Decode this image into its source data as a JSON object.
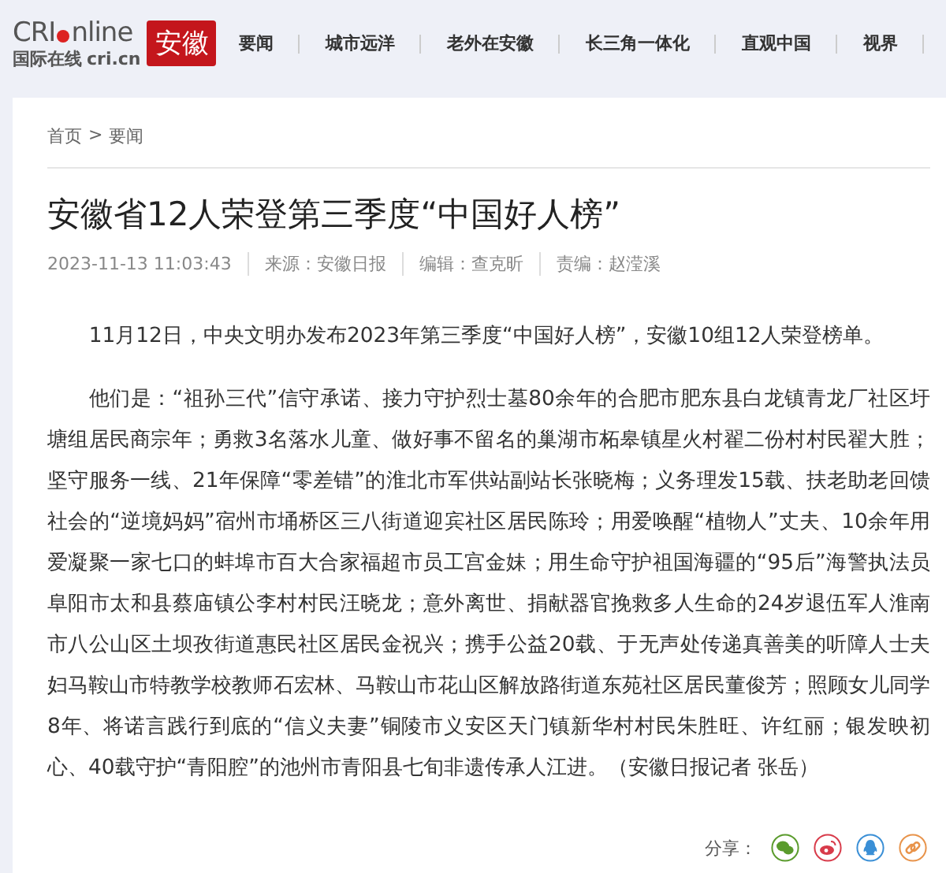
{
  "header": {
    "logo": {
      "brand_left": "CRI",
      "brand_right": "nline",
      "tagline": "国际在线",
      "domain": "cri.cn",
      "channel": "安徽"
    },
    "nav": [
      {
        "label": "要闻"
      },
      {
        "label": "城市远洋"
      },
      {
        "label": "老外在安徽"
      },
      {
        "label": "长三角一体化"
      },
      {
        "label": "直观中国"
      },
      {
        "label": "视界"
      }
    ]
  },
  "breadcrumb": [
    "首页",
    "要闻"
  ],
  "breadcrumb_separator": ">",
  "article": {
    "title": "安徽省12人荣登第三季度“中国好人榜”",
    "meta": [
      "2023-11-13 11:03:43",
      "来源：安徽日报",
      "编辑：查克昕",
      "责编：赵滢溪"
    ],
    "paragraphs": [
      "11月12日，中央文明办发布2023年第三季度“中国好人榜”，安徽10组12人荣登榜单。",
      "他们是：“祖孙三代”信守承诺、接力守护烈士墓80余年的合肥市肥东县白龙镇青龙厂社区圩塘组居民商宗年；勇救3名落水儿童、做好事不留名的巢湖市柘皋镇星火村翟二份村村民翟大胜；坚守服务一线、21年保障“零差错”的淮北市军供站副站长张晓梅；义务理发15载、扶老助老回馈社会的“逆境妈妈”宿州市埇桥区三八街道迎宾社区居民陈玲；用爱唤醒“植物人”丈夫、10余年用爱凝聚一家七口的蚌埠市百大合家福超市员工宫金妹；用生命守护祖国海疆的“95后”海警执法员阜阳市太和县蔡庙镇公李村村民汪晓龙；意外离世、捐献器官挽救多人生命的24岁退伍军人淮南市八公山区土坝孜街道惠民社区居民金祝兴；携手公益20载、于无声处传递真善美的听障人士夫妇马鞍山市特教学校教师石宏林、马鞍山市花山区解放路街道东苑社区居民董俊芳；照顾女儿同学8年、将诺言践行到底的“信义夫妻”铜陵市义安区天门镇新华村村民朱胜旺、许红丽；银发映初心、40载守护“青阳腔”的池州市青阳县七旬非遗传承人江进。（安徽日报记者 张岳）"
    ]
  },
  "share": {
    "label": "分享："
  }
}
